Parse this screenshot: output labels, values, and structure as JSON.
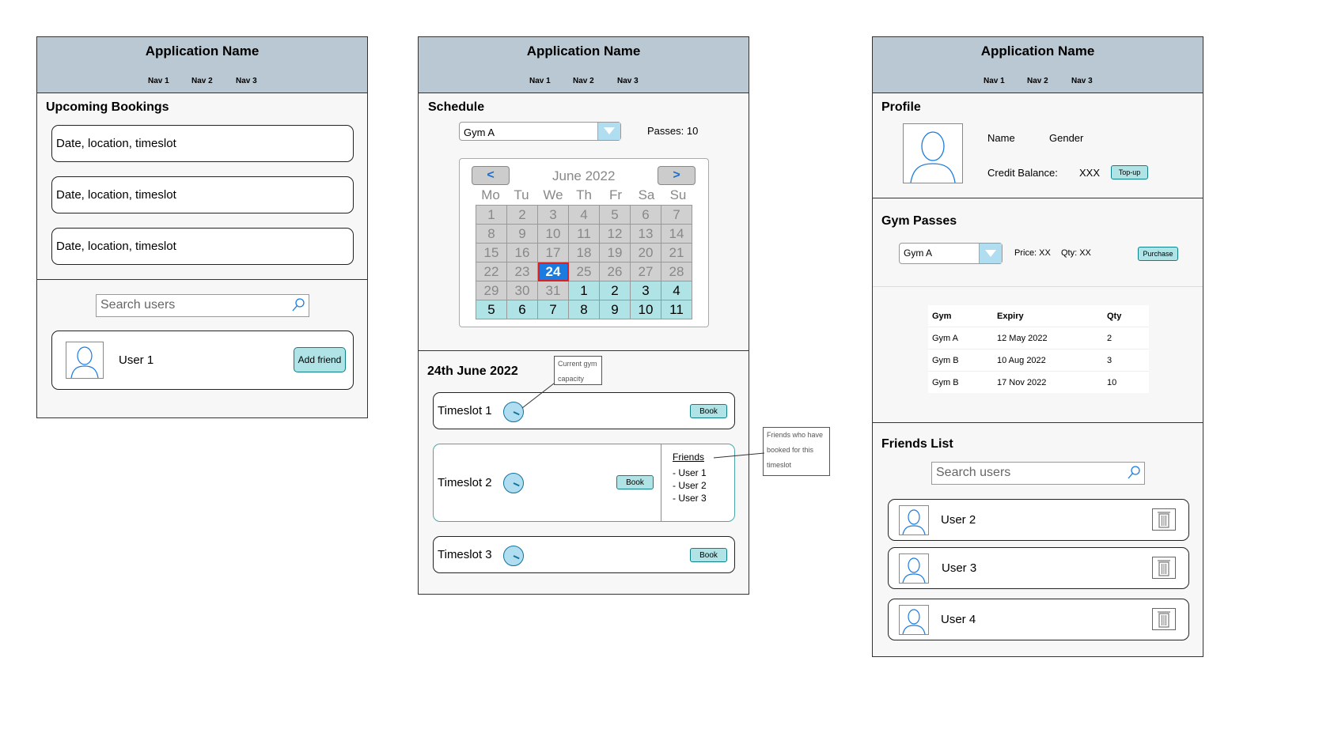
{
  "app_name": "Application Name",
  "nav": [
    "Nav 1",
    "Nav 2",
    "Nav 3"
  ],
  "home": {
    "upcoming_title": "Upcoming Bookings",
    "bookings": [
      "Date, location, timeslot",
      "Date, location, timeslot",
      "Date, location, timeslot"
    ],
    "search_placeholder": "Search users",
    "result_user": "User 1",
    "add_friend_label": "Add friend"
  },
  "schedule": {
    "title": "Schedule",
    "gym_select": "Gym A",
    "passes": "Passes: 10",
    "calendar": {
      "month_label": "June 2022",
      "prev": "<",
      "next": ">",
      "weekdays": [
        "Mo",
        "Tu",
        "We",
        "Th",
        "Fr",
        "Sa",
        "Su"
      ],
      "weeks": [
        [
          "1",
          "2",
          "3",
          "4",
          "5",
          "6",
          "7"
        ],
        [
          "8",
          "9",
          "10",
          "11",
          "12",
          "13",
          "14"
        ],
        [
          "15",
          "16",
          "17",
          "18",
          "19",
          "20",
          "21"
        ],
        [
          "22",
          "23",
          "24",
          "25",
          "26",
          "27",
          "28"
        ],
        [
          "29",
          "30",
          "31",
          "1",
          "2",
          "3",
          "4"
        ],
        [
          "5",
          "6",
          "7",
          "8",
          "9",
          "10",
          "11"
        ]
      ],
      "selected": "24"
    },
    "date_title": "24th June 2022",
    "timeslots": [
      "Timeslot 1",
      "Timeslot 2",
      "Timeslot 3"
    ],
    "book_label": "Book",
    "friends_title": "Friends",
    "friends": [
      "- User 1",
      "- User 2",
      "- User 3"
    ],
    "note_capacity": "Current gym capacity",
    "note_friends": "Friends who have booked for this timeslot"
  },
  "profile": {
    "title": "Profile",
    "name_label": "Name",
    "gender_label": "Gender",
    "credit_label": "Credit Balance:",
    "credit_value": "XXX",
    "topup_label": "Top-up",
    "passes_title": "Gym Passes",
    "gym_select": "Gym A",
    "price": "Price: XX",
    "qty": "Qty: XX",
    "purchase_label": "Purchase",
    "table": {
      "headers": [
        "Gym",
        "Expiry",
        "Qty"
      ],
      "rows": [
        [
          "Gym A",
          "12 May 2022",
          "2"
        ],
        [
          "Gym B",
          "10 Aug 2022",
          "3"
        ],
        [
          "Gym B",
          "17 Nov 2022",
          "10"
        ]
      ]
    },
    "friends_title": "Friends List",
    "search_placeholder": "Search users",
    "friends": [
      "User 2",
      "User 3",
      "User 4"
    ]
  },
  "colors": {
    "header": "#bac8d3",
    "teal": "#b0e3e6",
    "selected": "#1a7be0",
    "past": "#d0d0d0"
  },
  "icons": [
    "search-icon",
    "avatar-icon",
    "clock-icon",
    "dropdown-arrow-icon",
    "trash-icon"
  ]
}
